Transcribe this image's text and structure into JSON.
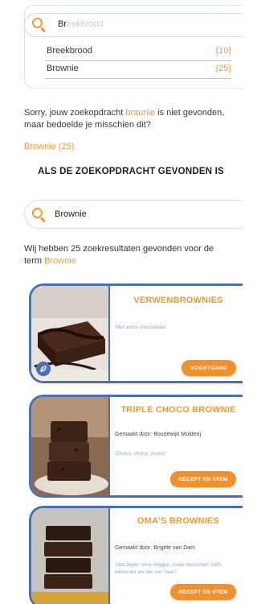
{
  "top_search": {
    "typed": "Br",
    "ghost": "eekbrood",
    "suggestions": [
      {
        "name": "Breekbrood",
        "count": "(10)"
      },
      {
        "name": "Brownie",
        "count": "(25)"
      }
    ]
  },
  "no_result": {
    "prefix": "Sorry, jouw zoekopdracht ",
    "term": "braunie",
    "suffix": " is niet gevonden,",
    "line2": "maar bedoelde je misschien dit?",
    "suggestion": "Brownie  (25)"
  },
  "section_heading": "ALS DE ZOEKOPDRACHT GEVONDEN IS",
  "second_search": {
    "value": "Brownie"
  },
  "results": {
    "line1": "Wij hebben 25 zoekresultaten gevonden voor de",
    "line2_prefix": "term ",
    "term": "Brownie"
  },
  "cards": [
    {
      "title": "VERWENBROWNIES",
      "author": "",
      "tagline": "'Met extra chocolalala'",
      "button": "VOORTGANG"
    },
    {
      "title": "TRIPLE CHOCO BROWNIE",
      "author": "Gemaakt door: Boudewijn Muldenj",
      "tagline": "'Choco, choco, chooo'",
      "button": "RECEPT EN STEM"
    },
    {
      "title": "OMA'S BROWNIES",
      "author": "Gemaakt door: Brigitte van Dam",
      "tagline": "'Niet tegen oma zeggen, maar misschien zelfs lekkerder als die van haar!'",
      "button": "RECEPT EN STEM"
    }
  ],
  "colors": {
    "accent": "#f29a2e",
    "card_border": "#4a6fb3"
  }
}
